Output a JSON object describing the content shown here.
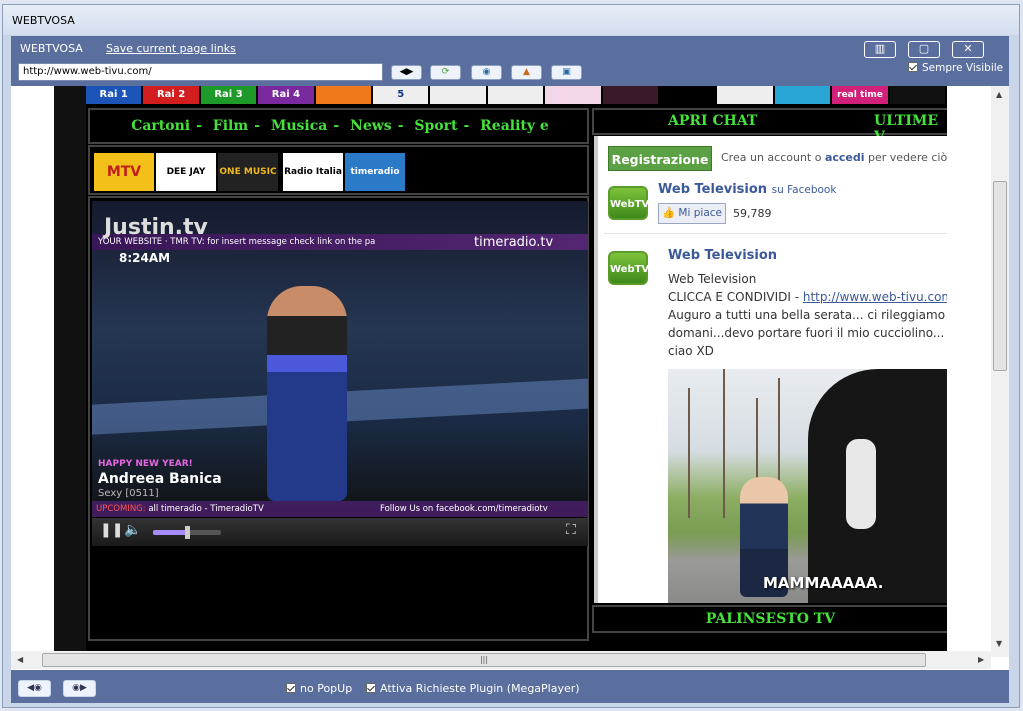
{
  "window": {
    "title": "WEBTVOSA"
  },
  "header": {
    "app_name": "WEBTVOSA",
    "save_link": "Save current page links",
    "url": "http://www.web-tivu.com/",
    "tool_buttons": [
      "back-icon",
      "refresh-icon",
      "go-icon",
      "home-icon",
      "favorite-icon"
    ],
    "window_buttons": [
      "fullscreen-icon",
      "restore-icon",
      "close-icon"
    ],
    "always_visible_label": "Sempre Visibile",
    "always_visible_checked": true
  },
  "site": {
    "channel_logos": [
      "Rai 1",
      "Rai 2",
      "Rai 3",
      "Rai 4",
      "",
      "5",
      "",
      "",
      "",
      "",
      "",
      "",
      "",
      "real time",
      ""
    ],
    "nav": [
      "Cartoni",
      "Film",
      "Musica",
      "News",
      "Sport",
      "Reality e curiosità"
    ],
    "nav_sep": "-",
    "channels": [
      "MTV",
      "DEE JAY",
      "ONE MUSIC",
      "Radio Italia",
      "timeradio"
    ],
    "player": {
      "brand": "Justin.tv",
      "ticker": "YOUR WEBSITE  ·  TMR TV: for insert message check link on the pa",
      "station": "timeradio.tv",
      "clock": "8:24AM",
      "greeting": "HAPPY NEW YEAR!",
      "artist": "Andreea Banica",
      "song": "Sexy [0511]",
      "upcoming_label": "UPCOMING:",
      "upcoming": "all timeradio - TimeradioTV",
      "follow": "Follow Us on facebook.com/timeradiotv",
      "volume_fraction": 0.5
    },
    "right_header": {
      "apri_chat": "APRI CHAT",
      "ultime": "ULTIME V"
    },
    "facebook": {
      "register_button": "Registrazione",
      "account_text_pre": "Crea un account o ",
      "account_link": "accedi",
      "account_text_post": " per vedere ciò che p",
      "page_name": "Web Television",
      "on_facebook": "su Facebook",
      "like_button": "Mi piace",
      "like_count": "59,789",
      "post_author": "Web Television",
      "post_line1": "Web Television",
      "post_line2_pre": "CLICCA E CONDIVIDI - ",
      "post_link": "http://www.web-tivu.com/",
      "post_line3": "Auguro a tutti una bella serata... ci rileggiamo domani...devo portare fuori il mio cucciolino... ciao XD",
      "photo_caption": "MAMMAAAAA.",
      "tv_icon_text": "WebTV"
    },
    "palinsesto": "PALINSESTO TV"
  },
  "footer": {
    "no_popup_label": "no PopUp",
    "no_popup_checked": true,
    "plugin_label": "Attiva Richieste Plugin (MegaPlayer)",
    "plugin_checked": true,
    "buttons": [
      "back-icon",
      "forward-icon"
    ]
  },
  "colors": {
    "frame": "#5a6f9e",
    "nav_green": "#44e23a",
    "fb_blue": "#3b5998",
    "fb_green": "#5ba042"
  }
}
